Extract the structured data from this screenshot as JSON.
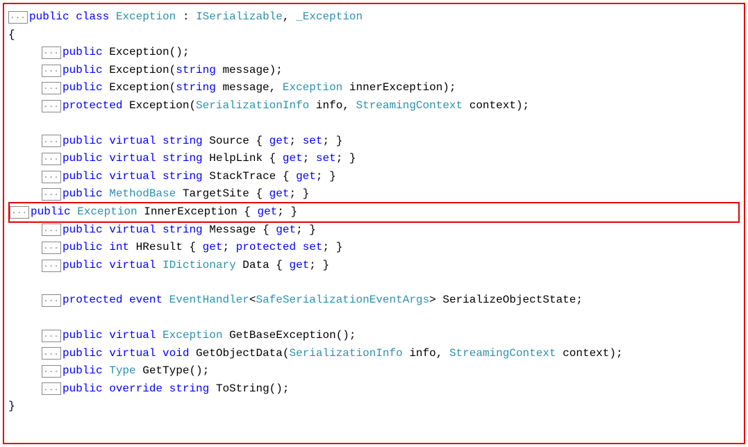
{
  "expand_label": "...",
  "header": {
    "t1": "public",
    "t2": " ",
    "t3": "class",
    "t4": " ",
    "t5": "Exception",
    "t6": " : ",
    "t7": "ISerializable",
    "t8": ", ",
    "t9": "_Exception"
  },
  "open_brace": "{",
  "close_brace": "}",
  "lines": [
    {
      "id": "ctor1",
      "seg": [
        [
          "kw",
          "public"
        ],
        [
          "plain",
          " Exception();"
        ]
      ]
    },
    {
      "id": "ctor2",
      "seg": [
        [
          "kw",
          "public"
        ],
        [
          "plain",
          " Exception("
        ],
        [
          "kw",
          "string"
        ],
        [
          "plain",
          " message);"
        ]
      ]
    },
    {
      "id": "ctor3",
      "seg": [
        [
          "kw",
          "public"
        ],
        [
          "plain",
          " Exception("
        ],
        [
          "kw",
          "string"
        ],
        [
          "plain",
          " message, "
        ],
        [
          "type",
          "Exception"
        ],
        [
          "plain",
          " innerException);"
        ]
      ]
    },
    {
      "id": "ctor4",
      "seg": [
        [
          "kw",
          "protected"
        ],
        [
          "plain",
          " Exception("
        ],
        [
          "type",
          "SerializationInfo"
        ],
        [
          "plain",
          " info, "
        ],
        [
          "type",
          "StreamingContext"
        ],
        [
          "plain",
          " context);"
        ]
      ]
    },
    {
      "id": "spacer1",
      "spacer": true
    },
    {
      "id": "prop1",
      "seg": [
        [
          "kw",
          "public"
        ],
        [
          "plain",
          " "
        ],
        [
          "kw",
          "virtual"
        ],
        [
          "plain",
          " "
        ],
        [
          "kw",
          "string"
        ],
        [
          "plain",
          " Source { "
        ],
        [
          "kw",
          "get"
        ],
        [
          "plain",
          "; "
        ],
        [
          "kw",
          "set"
        ],
        [
          "plain",
          "; }"
        ]
      ]
    },
    {
      "id": "prop2",
      "seg": [
        [
          "kw",
          "public"
        ],
        [
          "plain",
          " "
        ],
        [
          "kw",
          "virtual"
        ],
        [
          "plain",
          " "
        ],
        [
          "kw",
          "string"
        ],
        [
          "plain",
          " HelpLink { "
        ],
        [
          "kw",
          "get"
        ],
        [
          "plain",
          "; "
        ],
        [
          "kw",
          "set"
        ],
        [
          "plain",
          "; }"
        ]
      ]
    },
    {
      "id": "prop3",
      "seg": [
        [
          "kw",
          "public"
        ],
        [
          "plain",
          " "
        ],
        [
          "kw",
          "virtual"
        ],
        [
          "plain",
          " "
        ],
        [
          "kw",
          "string"
        ],
        [
          "plain",
          " StackTrace { "
        ],
        [
          "kw",
          "get"
        ],
        [
          "plain",
          "; }"
        ]
      ]
    },
    {
      "id": "prop4",
      "seg": [
        [
          "kw",
          "public"
        ],
        [
          "plain",
          " "
        ],
        [
          "type",
          "MethodBase"
        ],
        [
          "plain",
          " TargetSite { "
        ],
        [
          "kw",
          "get"
        ],
        [
          "plain",
          "; }"
        ]
      ]
    },
    {
      "id": "prop5",
      "highlight": true,
      "seg": [
        [
          "kw",
          "public"
        ],
        [
          "plain",
          " "
        ],
        [
          "type",
          "Exception"
        ],
        [
          "plain",
          " InnerException { "
        ],
        [
          "kw",
          "get"
        ],
        [
          "plain",
          "; }"
        ]
      ]
    },
    {
      "id": "prop6",
      "seg": [
        [
          "kw",
          "public"
        ],
        [
          "plain",
          " "
        ],
        [
          "kw",
          "virtual"
        ],
        [
          "plain",
          " "
        ],
        [
          "kw",
          "string"
        ],
        [
          "plain",
          " Message { "
        ],
        [
          "kw",
          "get"
        ],
        [
          "plain",
          "; }"
        ]
      ]
    },
    {
      "id": "prop7",
      "seg": [
        [
          "kw",
          "public"
        ],
        [
          "plain",
          " "
        ],
        [
          "kw",
          "int"
        ],
        [
          "plain",
          " HResult { "
        ],
        [
          "kw",
          "get"
        ],
        [
          "plain",
          "; "
        ],
        [
          "kw",
          "protected"
        ],
        [
          "plain",
          " "
        ],
        [
          "kw",
          "set"
        ],
        [
          "plain",
          "; }"
        ]
      ]
    },
    {
      "id": "prop8",
      "seg": [
        [
          "kw",
          "public"
        ],
        [
          "plain",
          " "
        ],
        [
          "kw",
          "virtual"
        ],
        [
          "plain",
          " "
        ],
        [
          "type",
          "IDictionary"
        ],
        [
          "plain",
          " Data { "
        ],
        [
          "kw",
          "get"
        ],
        [
          "plain",
          "; }"
        ]
      ]
    },
    {
      "id": "spacer2",
      "spacer": true
    },
    {
      "id": "evt1",
      "seg": [
        [
          "kw",
          "protected"
        ],
        [
          "plain",
          " "
        ],
        [
          "kw",
          "event"
        ],
        [
          "plain",
          " "
        ],
        [
          "type",
          "EventHandler"
        ],
        [
          "punct",
          "<"
        ],
        [
          "type",
          "SafeSerializationEventArgs"
        ],
        [
          "punct",
          ">"
        ],
        [
          "plain",
          " SerializeObjectState;"
        ]
      ]
    },
    {
      "id": "spacer3",
      "spacer": true
    },
    {
      "id": "m1",
      "seg": [
        [
          "kw",
          "public"
        ],
        [
          "plain",
          " "
        ],
        [
          "kw",
          "virtual"
        ],
        [
          "plain",
          " "
        ],
        [
          "type",
          "Exception"
        ],
        [
          "plain",
          " GetBaseException();"
        ]
      ]
    },
    {
      "id": "m2",
      "seg": [
        [
          "kw",
          "public"
        ],
        [
          "plain",
          " "
        ],
        [
          "kw",
          "virtual"
        ],
        [
          "plain",
          " "
        ],
        [
          "kw",
          "void"
        ],
        [
          "plain",
          " GetObjectData("
        ],
        [
          "type",
          "SerializationInfo"
        ],
        [
          "plain",
          " info, "
        ],
        [
          "type",
          "StreamingContext"
        ],
        [
          "plain",
          " context);"
        ]
      ]
    },
    {
      "id": "m3",
      "seg": [
        [
          "kw",
          "public"
        ],
        [
          "plain",
          " "
        ],
        [
          "type",
          "Type"
        ],
        [
          "plain",
          " GetType();"
        ]
      ]
    },
    {
      "id": "m4",
      "seg": [
        [
          "kw",
          "public"
        ],
        [
          "plain",
          " "
        ],
        [
          "kw",
          "override"
        ],
        [
          "plain",
          " "
        ],
        [
          "kw",
          "string"
        ],
        [
          "plain",
          " ToString();"
        ]
      ]
    }
  ]
}
